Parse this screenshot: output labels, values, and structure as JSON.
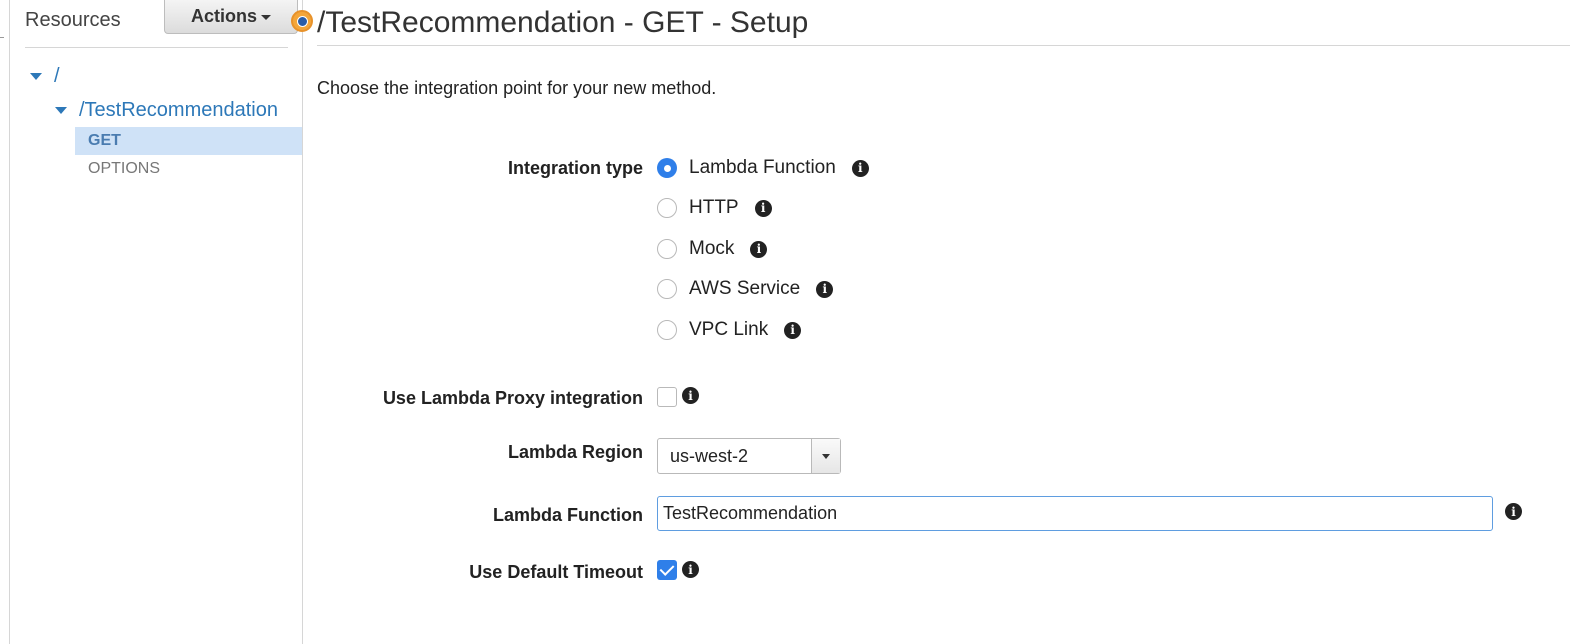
{
  "sidebar": {
    "header": "Resources",
    "actions_label": "Actions",
    "tree": {
      "root": "/",
      "resource": "/TestRecommendation",
      "methods": [
        {
          "label": "GET",
          "selected": true
        },
        {
          "label": "OPTIONS",
          "selected": false
        }
      ]
    }
  },
  "main": {
    "title": "/TestRecommendation - GET - Setup",
    "intro": "Choose the integration point for your new method.",
    "integration_type": {
      "label": "Integration type",
      "options": [
        {
          "label": "Lambda Function",
          "checked": true
        },
        {
          "label": "HTTP",
          "checked": false
        },
        {
          "label": "Mock",
          "checked": false
        },
        {
          "label": "AWS Service",
          "checked": false
        },
        {
          "label": "VPC Link",
          "checked": false
        }
      ]
    },
    "proxy": {
      "label": "Use Lambda Proxy integration",
      "checked": false
    },
    "region": {
      "label": "Lambda Region",
      "value": "us-west-2"
    },
    "function": {
      "label": "Lambda Function",
      "value": "TestRecommendation"
    },
    "timeout": {
      "label": "Use Default Timeout",
      "checked": true
    }
  },
  "icons": {
    "info": "i",
    "colors": {
      "accent": "#2f7fe9",
      "link": "#2d78b8",
      "selected_bg": "#cfe2f7",
      "status": "#f4a63a"
    }
  }
}
